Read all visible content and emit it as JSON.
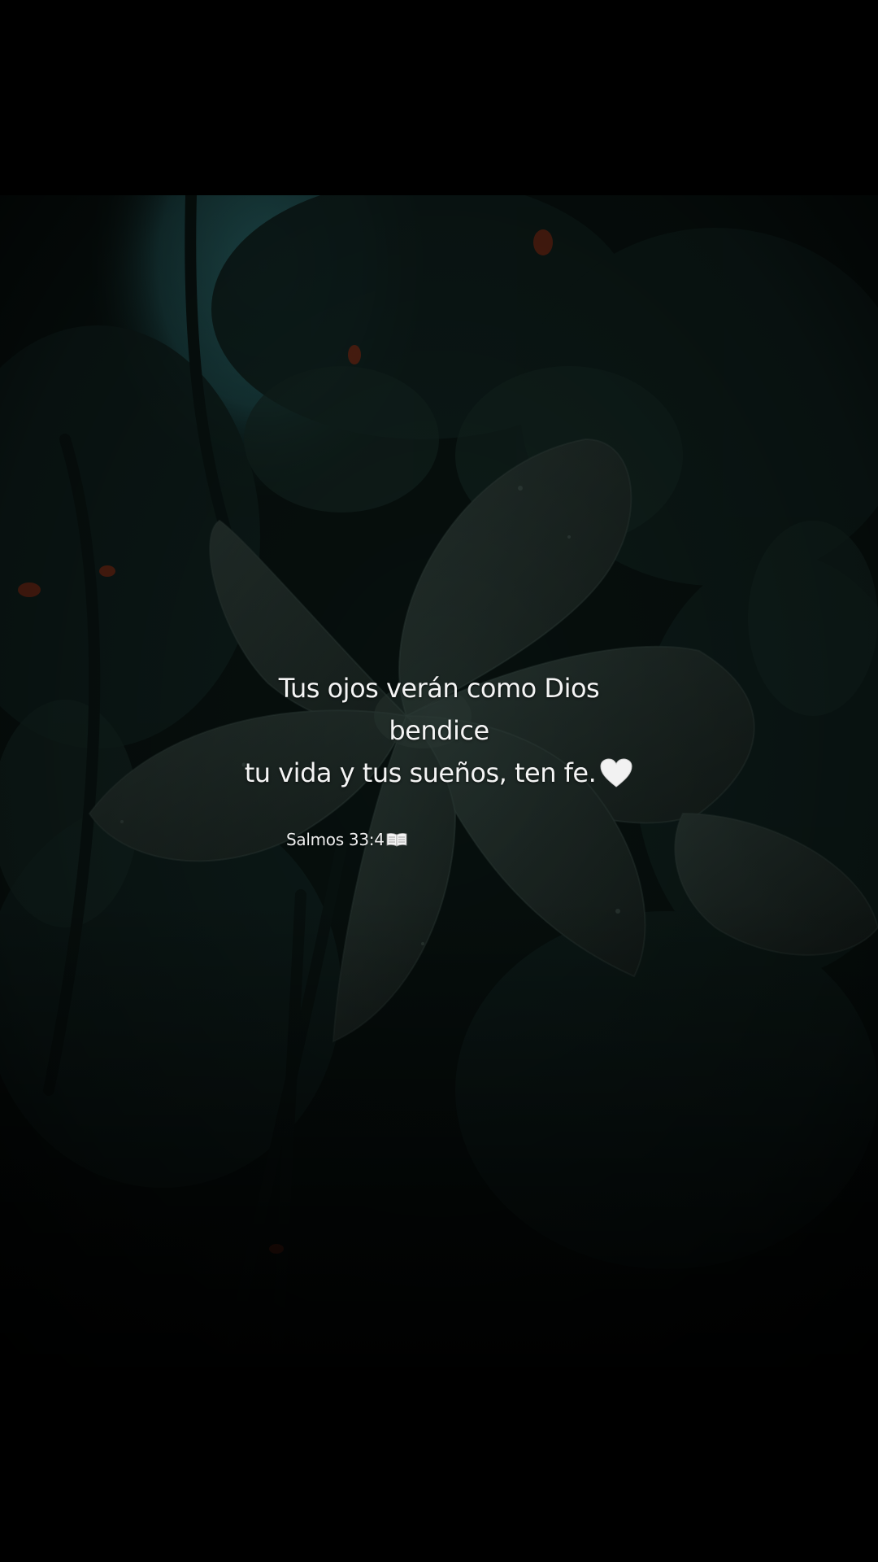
{
  "caption": {
    "line1": "Tus ojos verán como Dios",
    "line2": "bendice",
    "line3": "tu vida y tus sueños, ten fe.",
    "line3_emoji": "white-heart-icon"
  },
  "verse": {
    "reference": "Salmos 33:4",
    "emoji": "open-book-icon"
  },
  "colors": {
    "background": "#000000",
    "text": "#f4f4f4",
    "sky": "#1e4a4c",
    "foliage": "#0c1a17",
    "flower": "#1d2926",
    "accent_leaf": "#7a2a14"
  }
}
